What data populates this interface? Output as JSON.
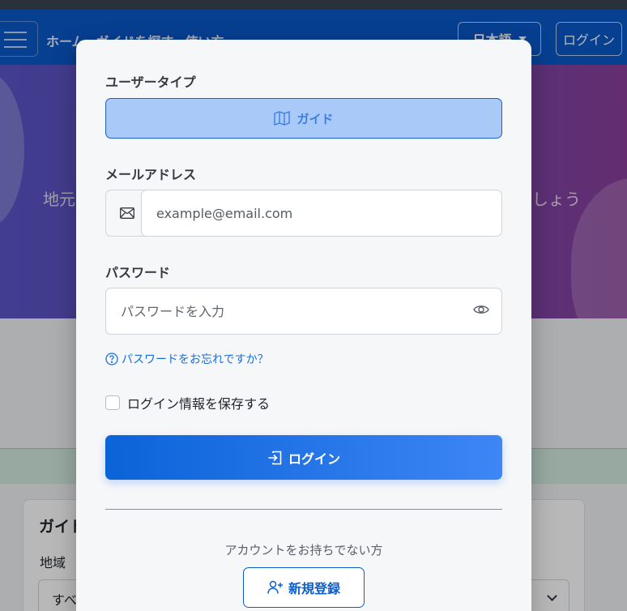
{
  "navbar": {
    "links": [
      "ホーム",
      "ガイドを探す",
      "使い方"
    ],
    "language": "日本語",
    "login": "ログイン"
  },
  "hero": {
    "subtitle_left": "地元",
    "subtitle_right": "しょう"
  },
  "background": {
    "card_title": "ガイド",
    "region_label": "地域",
    "region_value": "すべ"
  },
  "modal": {
    "user_type_label": "ユーザータイプ",
    "user_type_option": "ガイド",
    "email_label": "メールアドレス",
    "email_placeholder": "example@email.com",
    "password_label": "パスワード",
    "password_placeholder": "パスワードを入力",
    "forgot_password": "パスワードをお忘れですか？",
    "remember_me": "ログイン情報を保存する",
    "login_button": "ログイン",
    "no_account": "アカウントをお持ちでない方",
    "register_button": "新規登録"
  },
  "colors": {
    "primary": "#0d6efd",
    "selected_bg": "#a9c9f8",
    "hero_gradient_start": "#5a55c8",
    "hero_gradient_end": "#8a3f9c"
  },
  "icons": {
    "user_type": "map-icon",
    "email": "envelope-icon",
    "password_toggle": "eye-icon",
    "forgot": "question-circle-icon",
    "login": "login-arrow-icon",
    "register": "person-plus-icon"
  }
}
